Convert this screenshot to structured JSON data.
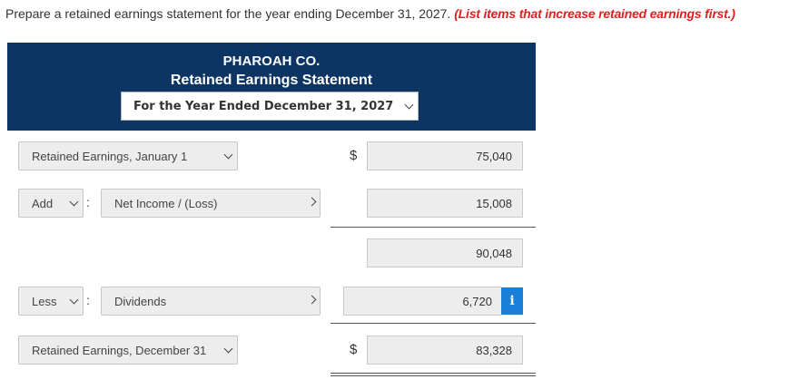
{
  "instruction": {
    "text": "Prepare a retained earnings statement for the year ending December 31, 2027.",
    "emphasis": "(List items that increase retained earnings first.)"
  },
  "header": {
    "company": "PHAROAH CO.",
    "title": "Retained Earnings Statement",
    "period_select": "For the Year Ended December 31, 2027"
  },
  "rows": {
    "beginning": {
      "label": "Retained Earnings, January 1",
      "currency": "$",
      "amount": "75,040"
    },
    "add": {
      "operator": "Add",
      "separator": ":",
      "label": "Net Income / (Loss)",
      "amount": "15,008"
    },
    "subtotal": {
      "amount": "90,048"
    },
    "less": {
      "operator": "Less",
      "separator": ":",
      "label": "Dividends",
      "amount": "6,720",
      "info_icon": "i"
    },
    "ending": {
      "label": "Retained Earnings, December 31",
      "currency": "$",
      "amount": "83,328"
    }
  },
  "colors": {
    "header_bg": "#0d3563",
    "emphasis": "#e02020",
    "info_button": "#1a7fd6"
  },
  "icons": [
    "chevron-down-icon",
    "chevron-right-icon",
    "info-icon"
  ]
}
